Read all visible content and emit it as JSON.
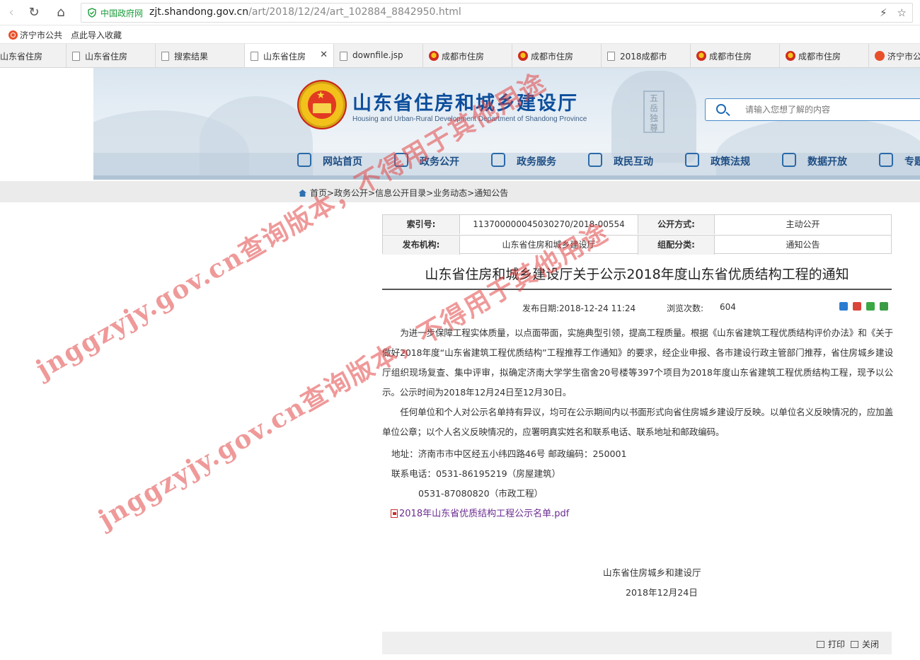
{
  "browser": {
    "nav": {
      "back": "‹",
      "reload": "↻",
      "home": "⌂"
    },
    "address": {
      "badge": "中国政府网",
      "url_host": "zjt.shandong.gov.cn",
      "url_path": "/art/2018/12/24/art_102884_8842950.html"
    },
    "bookmarks": [
      "济宁市公共",
      "点此导入收藏"
    ],
    "tabs": [
      {
        "label": "山东省住房",
        "icon": "gov-icon"
      },
      {
        "label": "山东省住房",
        "icon": "page-icon"
      },
      {
        "label": "搜索结果",
        "icon": "page-icon"
      },
      {
        "label": "山东省住房",
        "icon": "page-icon",
        "active": true
      },
      {
        "label": "downfile.jsp",
        "icon": "page-icon"
      },
      {
        "label": "成都市住房",
        "icon": "gov-icon"
      },
      {
        "label": "成都市住房",
        "icon": "gov-icon"
      },
      {
        "label": "2018成都市",
        "icon": "page-icon"
      },
      {
        "label": "成都市住房",
        "icon": "gov-icon"
      },
      {
        "label": "成都市住房",
        "icon": "gov-icon"
      },
      {
        "label": "济宁市公",
        "icon": "360-icon"
      }
    ]
  },
  "site": {
    "title": "山东省住房和城乡建设厅",
    "subtitle": "Housing and Urban-Rural Development Department of Shandong Province",
    "search_placeholder": "请输入您想了解的内容",
    "nav": [
      "网站首页",
      "政务公开",
      "政务服务",
      "政民互动",
      "政策法规",
      "数据开放",
      "专题"
    ]
  },
  "breadcrumb": "首页>政务公开>信息公开目录>业务动态>通知公告",
  "meta": {
    "index_label": "索引号:",
    "index_value": "113700000045030270/2018-00554",
    "open_label": "公开方式:",
    "open_value": "主动公开",
    "org_label": "发布机构:",
    "org_value": "山东省住房和城乡建设厅",
    "cat_label": "组配分类:",
    "cat_value": "通知公告"
  },
  "article": {
    "title": "山东省住房和城乡建设厅关于公示2018年度山东省优质结构工程的通知",
    "date": "发布日期:2018-12-24 11:24",
    "views_label": "浏览次数:",
    "views": "604",
    "para1": "为进一步保障工程实体质量，以点面带面，实施典型引领，提高工程质量。根据《山东省建筑工程优质结构评价办法》和《关于做好2018年度“山东省建筑工程优质结构”工程推荐工作通知》的要求，经企业申报、各市建设行政主管部门推荐，省住房城乡建设厅组织现场复查、集中评审，拟确定济南大学学生宿舍20号楼等397个项目为2018年度山东省建筑工程优质结构工程，现予以公示。公示时间为2018年12月24日至12月30日。",
    "para2": "任何单位和个人对公示名单持有异议，均可在公示期间内以书面形式向省住房城乡建设厅反映。以单位名义反映情况的，应加盖单位公章；以个人名义反映情况的，应署明真实姓名和联系电话、联系地址和邮政编码。",
    "address": "地址：济南市市中区经五小纬四路46号  邮政编码：250001",
    "phone1": "联系电话：0531-86195219（房屋建筑）",
    "phone2": "0531-87080820（市政工程）",
    "attachment": "2018年山东省优质结构工程公示名单.pdf",
    "sign_org": "山东省住房城乡和建设厅",
    "sign_date": "2018年12月24日"
  },
  "footer": {
    "print": "打印",
    "close": "关闭"
  },
  "watermark": {
    "line1": "jnggzyjy.gov.cn查询版本，不得用于其他用途",
    "line2": "jnggzyjy.gov.cn查询版本，不得用于其他用途"
  },
  "colors": {
    "brand_blue": "#0d4e9c",
    "watermark_red": "#e14646",
    "link_purple": "#6b2c91"
  }
}
